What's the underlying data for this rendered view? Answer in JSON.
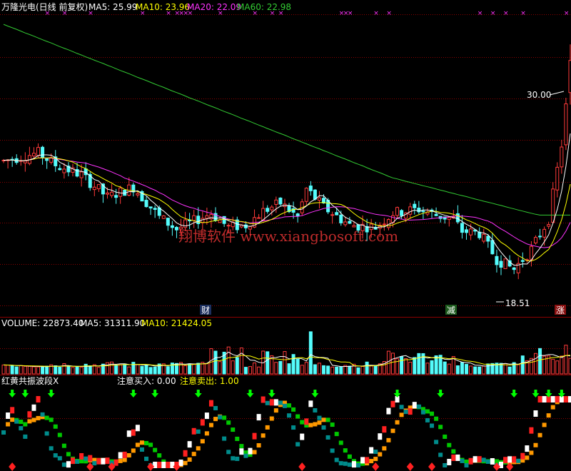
{
  "colors": {
    "bg": "#000000",
    "grid": "#8b0000",
    "up": "#ff3a3a",
    "down": "#54fcfc",
    "ma5": "#ffffff",
    "ma10": "#ffff00",
    "ma20": "#ff33ff",
    "ma60": "#33cc33",
    "buy_arrow": "#00ff00",
    "sell_arrow": "#ff2020",
    "osc_red": "#ff2020",
    "osc_white": "#ffffff",
    "osc_teal": "#008c8c",
    "osc_green": "#00c800",
    "osc_orange": "#ff9900",
    "watermark": "#ff3a3a"
  },
  "price_panel": {
    "title": "万隆光电(日线 前复权)",
    "ma_labels": [
      {
        "text": "MA5: 25.99",
        "color": "#ffffff"
      },
      {
        "text": "MA10: 23.96",
        "color": "#ffff00"
      },
      {
        "text": "MA20: 22.09",
        "color": "#ff33ff"
      },
      {
        "text": "MA60: 22.98",
        "color": "#33cc33"
      }
    ],
    "high_label": "30.00",
    "low_label": "18.51",
    "event_tags": [
      {
        "text": "财",
        "bg": "#1c2f5e"
      },
      {
        "text": "减",
        "bg": "#1d5a1d"
      },
      {
        "text": "涨",
        "bg": "#8a1010"
      }
    ],
    "watermark": "翔博软件 www.xiangbosoft.com"
  },
  "volume_panel": {
    "ma_labels": [
      {
        "text": "VOLUME: 22873.40",
        "color": "#ffffff"
      },
      {
        "text": "MA5: 31311.90",
        "color": "#ffffff"
      },
      {
        "text": "MA10: 21424.05",
        "color": "#ffff00"
      }
    ]
  },
  "osc_panel": {
    "name": "红黄共振波段X",
    "label_buy": "注意买入: 0.00",
    "label_sell": "注意卖出: 1.00"
  },
  "chart_data": {
    "type": "candlestick",
    "y_range": [
      17.0,
      31.5
    ],
    "candles": [],
    "volume": [],
    "ma": {
      "ma5": [],
      "ma10": [],
      "ma20": [],
      "ma60": []
    },
    "osc": []
  }
}
